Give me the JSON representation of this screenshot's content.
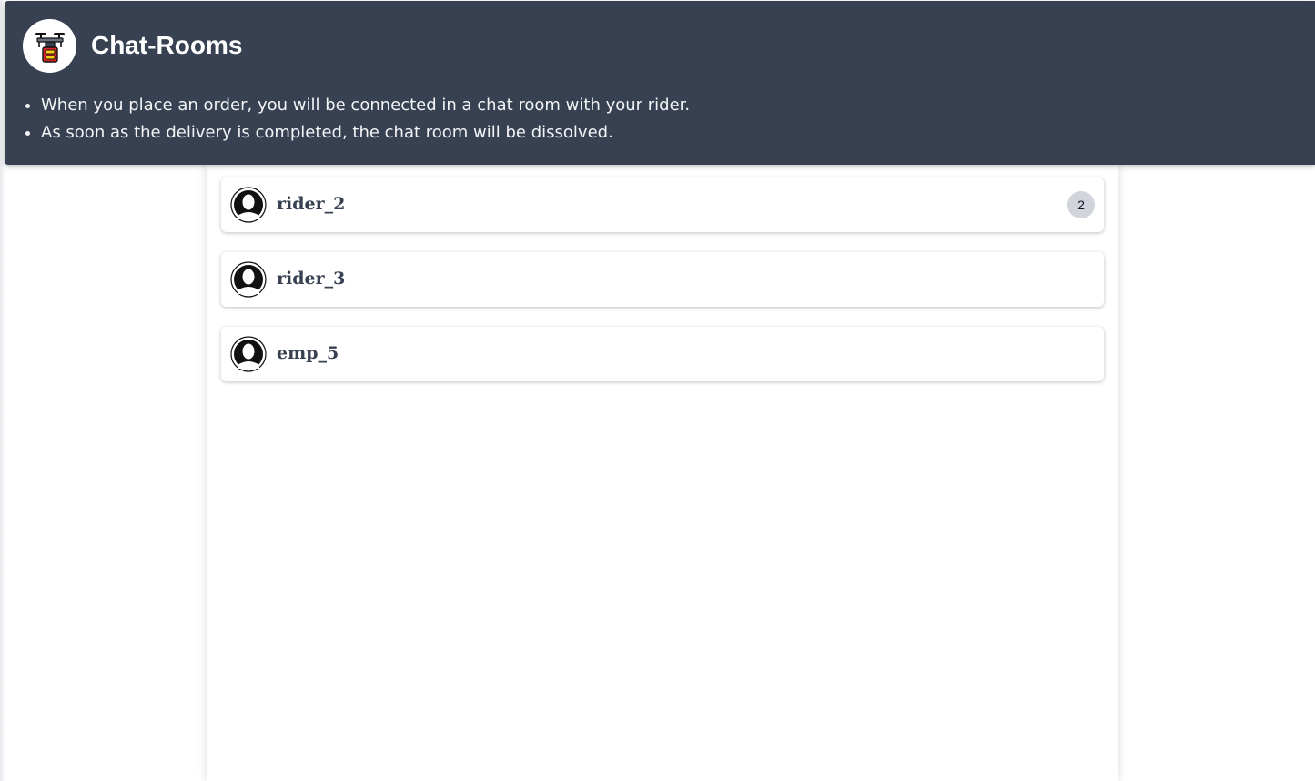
{
  "header": {
    "title": "Chat-Rooms",
    "logo_icon": "drone-delivery-icon",
    "notes": [
      "When you place an order, you will be connected in a chat room with your rider.",
      "As soon as the delivery is completed, the chat room will be dissolved."
    ],
    "background_color": "#374151"
  },
  "chat_rooms": [
    {
      "name": "rider_2",
      "unread": "2",
      "avatar_icon": "user-avatar-icon"
    },
    {
      "name": "rider_3",
      "unread": null,
      "avatar_icon": "user-avatar-icon"
    },
    {
      "name": "emp_5",
      "unread": null,
      "avatar_icon": "user-avatar-icon"
    }
  ]
}
